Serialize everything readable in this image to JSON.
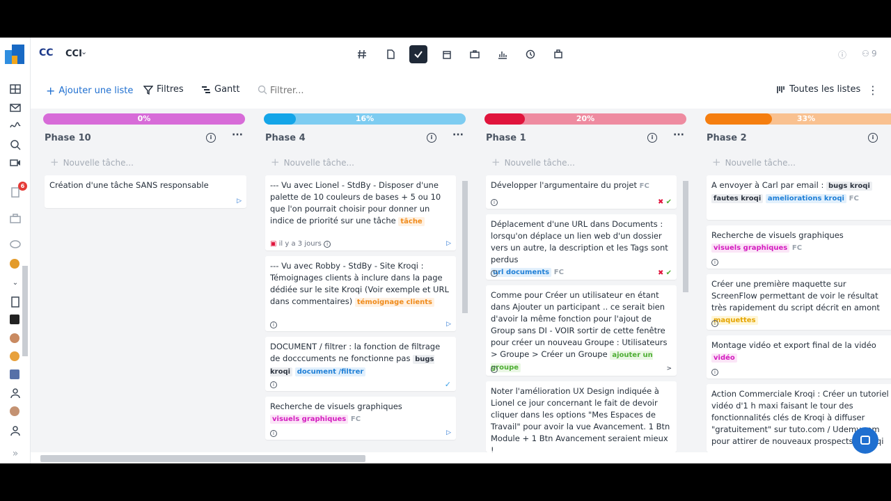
{
  "workspace": {
    "logo_text": "CC",
    "name": "CCI"
  },
  "topbar": {
    "tools": [
      "hash-icon",
      "document-icon",
      "check-icon",
      "calendar-icon",
      "briefcase-icon",
      "chart-icon",
      "history-icon",
      "org-icon"
    ],
    "members_count": "9"
  },
  "rail": {
    "notification_count": "6"
  },
  "actions": {
    "add_list": "Ajouter une liste",
    "filters": "Filtres",
    "gantt": "Gantt",
    "filter_placeholder": "Filtrer...",
    "all_lists": "Toutes les listes"
  },
  "new_task_label": "Nouvelle tâche...",
  "columns": [
    {
      "title": "Phase 10",
      "progress": 0,
      "progress_label": "0%",
      "track_color": "#d76bd8",
      "fill_color": "#c943cb",
      "cards": [
        {
          "text": "Création d'une tâche SANS responsable"
        }
      ]
    },
    {
      "title": "Phase 4",
      "progress": 16,
      "progress_label": "16%",
      "track_color": "#7dccf1",
      "fill_color": "#14a5e8",
      "cards": [
        {
          "text": "--- Vu avec Lionel - StdBy - Disposer d'une palette de 10 couleurs de bases + 5 ou 10 que l'on pourrait choisir pour donner un indice de priorité sur une tâche",
          "tag": "tâche",
          "date": "il y a 3 jours"
        },
        {
          "text": "--- Vu avec Robby - StdBy - Site Kroqi : Témoignages clients à inclure dans la page dédiée sur le site Kroqi (Voir exemple et URL dans commentaires)",
          "tag": "témoignage clients"
        },
        {
          "text": "DOCUMENT / filtrer : la fonction de filtrage de docccuments ne fonctionne pas",
          "tag1": "bugs kroqi",
          "tag2": "document /filtrer"
        },
        {
          "text": "Recherche de visuels graphiques",
          "tag": "visuels graphiques",
          "fc": "FC"
        }
      ]
    },
    {
      "title": "Phase 1",
      "progress": 20,
      "progress_label": "20%",
      "track_color": "#ee8ba0",
      "fill_color": "#e0143c",
      "cards": [
        {
          "text": "Développer l'argumentaire du projet",
          "fc": "FC"
        },
        {
          "text": "Déplacement d'une URL dans Documents : lorsqu'on déplace un lien web d'un dossier vers un autre, la description et les Tags sont perdus",
          "tag": "url documents",
          "fc": "FC"
        },
        {
          "text": "Comme pour Créer un utilisateur en étant dans Ajouter un participant .. ce serait bien d'avoir la même fonction pour l'ajout de Group sans DI - VOIR sortir de cette fenêtre pour créer un nouveau Groupe : Utilisateurs > Groupe > Créer un Groupe",
          "tag": "ajouter un groupe"
        },
        {
          "text": "Noter l'amélioration UX Design indiquée à Lionel ce jour concernant le fait de devoir cliquer dans les options \"Mes Espaces de Travail\" pour avoir la vue Avancement. 1 Btn Module + 1 Btn Avancement seraient mieux !"
        }
      ]
    },
    {
      "title": "Phase 2",
      "progress": 33,
      "progress_label": "33%",
      "track_color": "#f9c190",
      "fill_color": "#f57e0f",
      "cards": [
        {
          "text": "A envoyer à Carl par email :",
          "tag1": "bugs kroqi",
          "tag2": "fautes kroqi",
          "tag3": "ameliorations kroqi",
          "fc": "FC"
        },
        {
          "text": "Recherche de visuels graphiques",
          "tag": "visuels graphiques",
          "fc": "FC"
        },
        {
          "text": "Créer une première maquette sur ScreenFlow permettant de voir le résultat très rapidement du script décrit en amont",
          "tag": "maquettes"
        },
        {
          "text": "Montage vidéo et export final de la vidéo",
          "tag": "vidéo"
        },
        {
          "text": "Action Commerciale Kroqi : Créer un tutoriel vidéo d'1 h maxi faisant le tour des fonctionnalités clés de Kroqi à diffuser \"gratuitement\" sur tuto.com / Udemy.com pour attirer de nouveaux prospects à Kroqi"
        }
      ]
    }
  ]
}
